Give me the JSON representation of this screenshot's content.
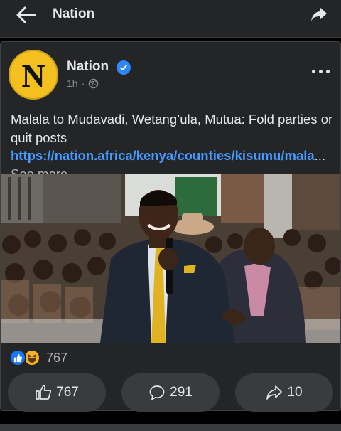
{
  "header": {
    "title": "Nation",
    "back_icon": "arrow-left-icon",
    "share_icon": "share-icon"
  },
  "post": {
    "avatar_letter": "N",
    "page_name": "Nation",
    "verified": true,
    "time": "1h",
    "separator": "·",
    "audience_icon": "globe-icon",
    "text": "Malala to Mudavadi, Wetang’ula, Mutua: Fold parties or quit posts ",
    "link": "https://nation.africa/kenya/counties/kisumu/mala",
    "ellipsis": "...",
    "see_more": " See more",
    "image_description": "Man in a dark suit and yellow tie speaking into a microphone in front of a crowd"
  },
  "stats": {
    "reaction_count": "767",
    "reaction_icons": [
      "like-icon",
      "haha-icon"
    ]
  },
  "actions": {
    "like_count": "767",
    "comment_count": "291",
    "share_count": "10"
  },
  "colors": {
    "background": "#000000",
    "surface": "#242526",
    "button": "#3a3b3c",
    "link": "#4599ff",
    "verified": "#2d88ff",
    "avatar": "#f4c020"
  }
}
